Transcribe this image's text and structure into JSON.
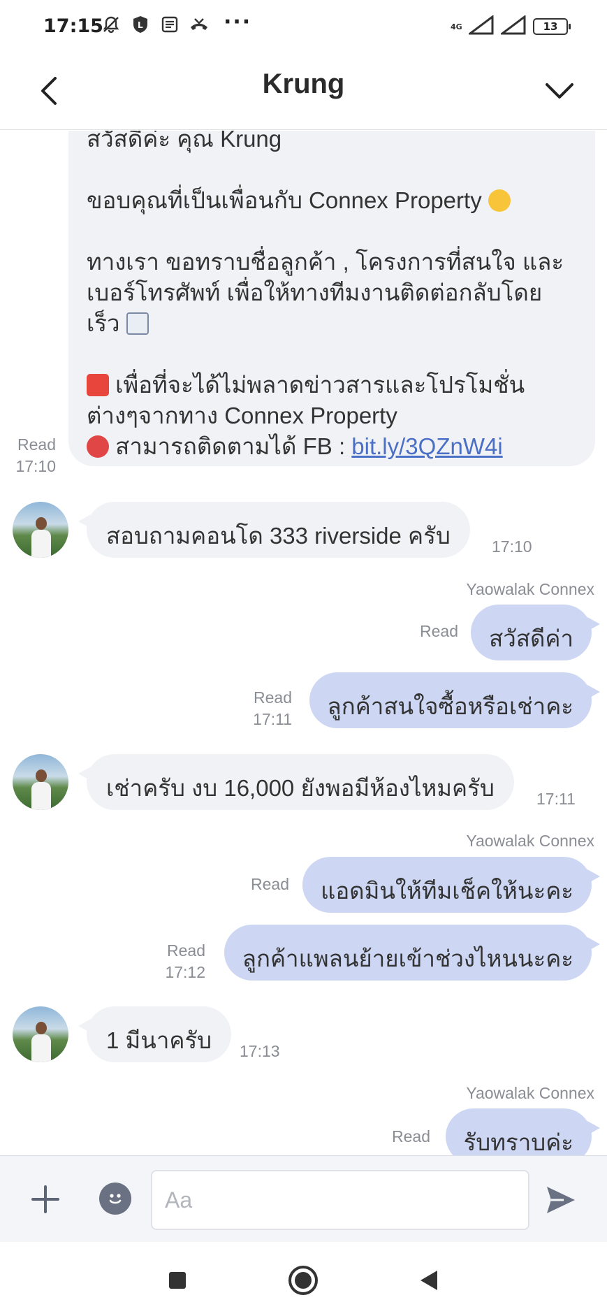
{
  "status_bar": {
    "time": "17:15",
    "network": "4G",
    "battery": "13",
    "more": "···"
  },
  "header": {
    "title": "Krung"
  },
  "messages": {
    "m1": {
      "lines": [
        "สวัสดีค่ะ คุณ Krung",
        "ขอบคุณที่เป็นเพื่อนกับ Connex Property",
        "ทางเรา ขอทราบชื่อลูกค้า , โครงการที่สนใจ และ",
        "เบอร์โทรศัพท์ เพื่อให้ทางทีมงานติดต่อกลับโดย",
        "เร็ว",
        "เพื่อที่จะได้ไม่พลาดข่าวสารและโปรโมชั่น",
        "ต่างๆจากทาง Connex Property",
        "สามารถติดตามได้ FB : "
      ],
      "link": "bit.ly/3QZnW4i",
      "read": "Read",
      "time": "17:10"
    },
    "m2": {
      "text": "สอบถามคอนโด 333 riverside ครับ",
      "time": "17:10"
    },
    "m3": {
      "sender": "Yaowalak Connex",
      "text": "สวัสดีค่า",
      "read": "Read"
    },
    "m4": {
      "text": "ลูกค้าสนใจซื้อหรือเช่าคะ",
      "read": "Read",
      "time": "17:11"
    },
    "m5": {
      "text": "เช่าครับ งบ 16,000 ยังพอมีห้องไหมครับ",
      "time": "17:11"
    },
    "m6": {
      "sender": "Yaowalak Connex",
      "text": "แอดมินให้ทีมเช็คให้นะคะ",
      "read": "Read"
    },
    "m7": {
      "text": "ลูกค้าแพลนย้ายเข้าช่วงไหนนะคะ",
      "read": "Read",
      "time": "17:12"
    },
    "m8": {
      "text": "1 มีนาครับ",
      "time": "17:13"
    },
    "m9": {
      "sender": "Yaowalak Connex",
      "text": "รับทราบค่ะ",
      "read": "Read"
    }
  },
  "input": {
    "placeholder": "Aa"
  },
  "colors": {
    "incoming_bubble": "#f1f2f5",
    "outgoing_bubble": "#cdd7f3",
    "link": "#4a6fc6",
    "meta_text": "#8a8d93"
  }
}
